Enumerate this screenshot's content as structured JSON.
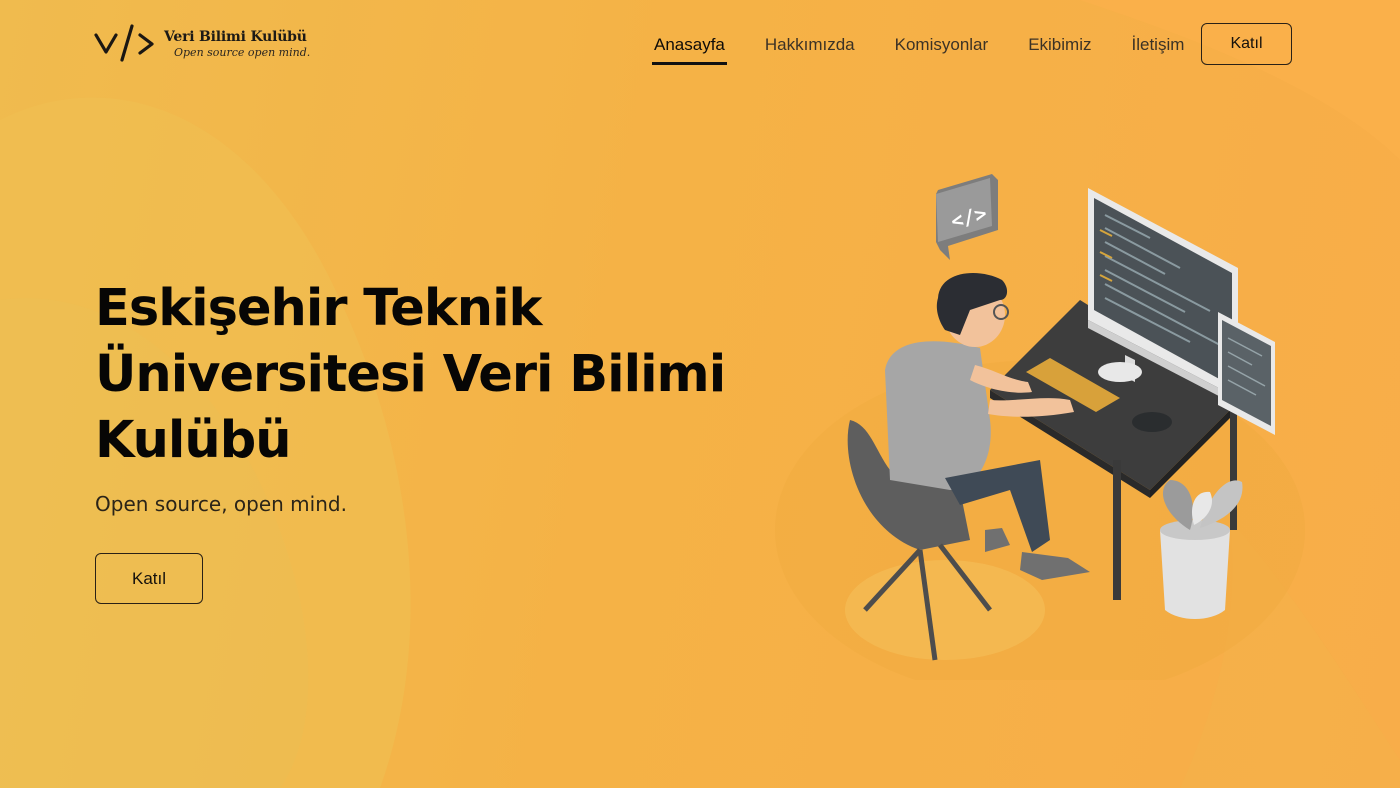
{
  "brand": {
    "name": "Veri Bilimi Kulübü",
    "slogan": "Open source open mind."
  },
  "nav": {
    "items": [
      {
        "label": "Anasayfa",
        "active": true
      },
      {
        "label": "Hakkımızda",
        "active": false
      },
      {
        "label": "Komisyonlar",
        "active": false
      },
      {
        "label": "Ekibimiz",
        "active": false
      },
      {
        "label": "İletişim",
        "active": false
      }
    ],
    "join_label": "Katıl"
  },
  "hero": {
    "title_lines": [
      "Eskişehir Teknik",
      "Üniversitesi Veri Bilimi",
      "Kulübü"
    ],
    "subtitle": "Open source, open mind.",
    "join_label": "Katıl"
  },
  "illustration": {
    "code_badge": "</>",
    "icon": "developer-at-computer-illustration"
  },
  "colors": {
    "background": "#f5b246",
    "text": "#070605",
    "button_border": "#2a2116"
  }
}
